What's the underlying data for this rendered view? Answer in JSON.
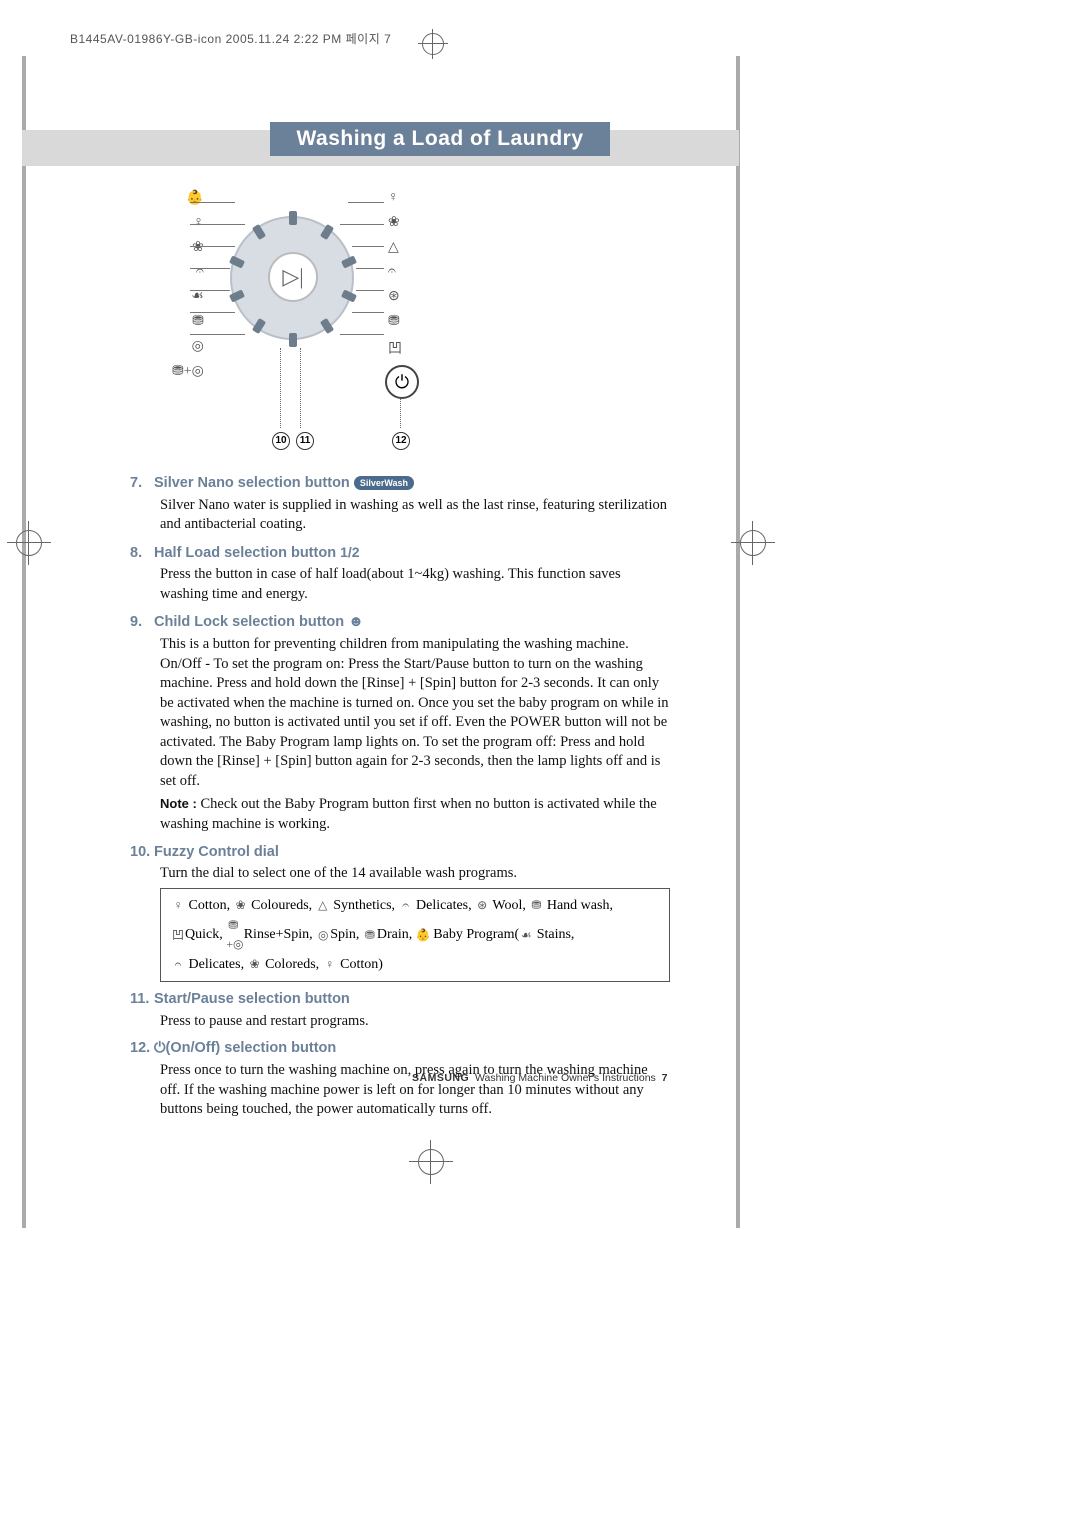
{
  "print_header": "B1445AV-01986Y-GB-icon  2005.11.24 2:22 PM 페이지 7",
  "title": "Washing a Load of Laundry",
  "diagram": {
    "callout_10": "10",
    "callout_11": "11",
    "callout_12": "12"
  },
  "sections": {
    "s7": {
      "num": "7.",
      "heading": "Silver Nano selection button",
      "badge": "SilverWash",
      "body": "Silver Nano water is supplied in washing as well as the last rinse, featuring sterilization and antibacterial coating."
    },
    "s8": {
      "num": "8.",
      "heading": "Half Load selection button",
      "icon": "1/2",
      "body": "Press the button in case of half load(about 1~4kg) washing. This function saves washing time and energy."
    },
    "s9": {
      "num": "9.",
      "heading": "Child Lock selection button",
      "body": "This is a button for preventing children from manipulating the washing machine. On/Off - To set the program on: Press the Start/Pause button to turn on the washing machine. Press and hold down the [Rinse] + [Spin] button for 2-3 seconds. It can only be activated when the machine is turned on. Once you set the baby program on while in washing, no button is activated until you set if off. Even the POWER button will not be activated. The Baby Program lamp lights on. To set the program off: Press and hold down the [Rinse] + [Spin] button again for 2-3 seconds, then the lamp lights off and is set off.",
      "note_label": "Note :",
      "note": "Check out the Baby Program button first when no button is activated while the washing machine is working."
    },
    "s10": {
      "num": "10.",
      "heading": "Fuzzy Control dial",
      "body": "Turn the dial to select one of the 14 available wash programs.",
      "programs": {
        "cotton": "Cotton,",
        "coloureds": "Coloureds,",
        "synthetics": "Synthetics,",
        "delicates": "Delicates,",
        "wool": "Wool,",
        "handwash": "Hand wash,",
        "quick": "Quick,",
        "rinsespin": "Rinse+Spin,",
        "spin": "Spin,",
        "drain": "Drain,",
        "baby": "Baby Program(",
        "stains": "Stains,",
        "delicates2": "Delicates,",
        "coloreds2": "Coloreds,",
        "cotton2": "Cotton)"
      }
    },
    "s11": {
      "num": "11.",
      "heading": "Start/Pause selection button",
      "body": "Press to pause and restart programs."
    },
    "s12": {
      "num": "12.",
      "heading": "(On/Off) selection button",
      "body": "Press once to turn the washing machine on, press again to turn the washing machine off. If the washing machine power is left on for longer than 10 minutes without any buttons being touched, the power automatically turns off."
    }
  },
  "footer": {
    "brand": "SAMSUNG",
    "text": "Washing Machine Owner's Instructions",
    "page": "7"
  }
}
